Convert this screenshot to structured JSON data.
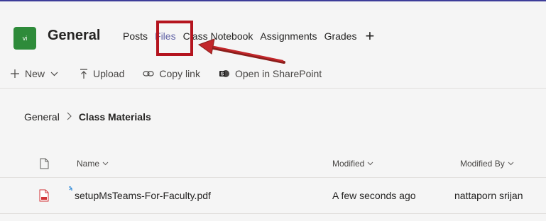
{
  "header": {
    "avatar_text": "vi",
    "title": "General",
    "tabs": [
      {
        "label": "Posts",
        "active": false
      },
      {
        "label": "Files",
        "active": true
      },
      {
        "label": "Class Notebook",
        "active": false
      },
      {
        "label": "Assignments",
        "active": false
      },
      {
        "label": "Grades",
        "active": false
      }
    ],
    "add_tab_symbol": "+"
  },
  "toolbar": {
    "new_label": "New",
    "upload_label": "Upload",
    "copy_link_label": "Copy link",
    "open_sharepoint_label": "Open in SharePoint"
  },
  "breadcrumb": {
    "root": "General",
    "current": "Class Materials"
  },
  "table": {
    "columns": {
      "name": "Name",
      "modified": "Modified",
      "modified_by": "Modified By"
    },
    "rows": [
      {
        "name": "setupMsTeams-For-Faculty.pdf",
        "modified": "A few seconds ago",
        "modified_by": "nattaporn srijan"
      }
    ]
  },
  "colors": {
    "accent": "#6264a7",
    "avatar_bg": "#2e8b3a",
    "annotation_red": "#b4141e",
    "pdf_red": "#d13438"
  }
}
